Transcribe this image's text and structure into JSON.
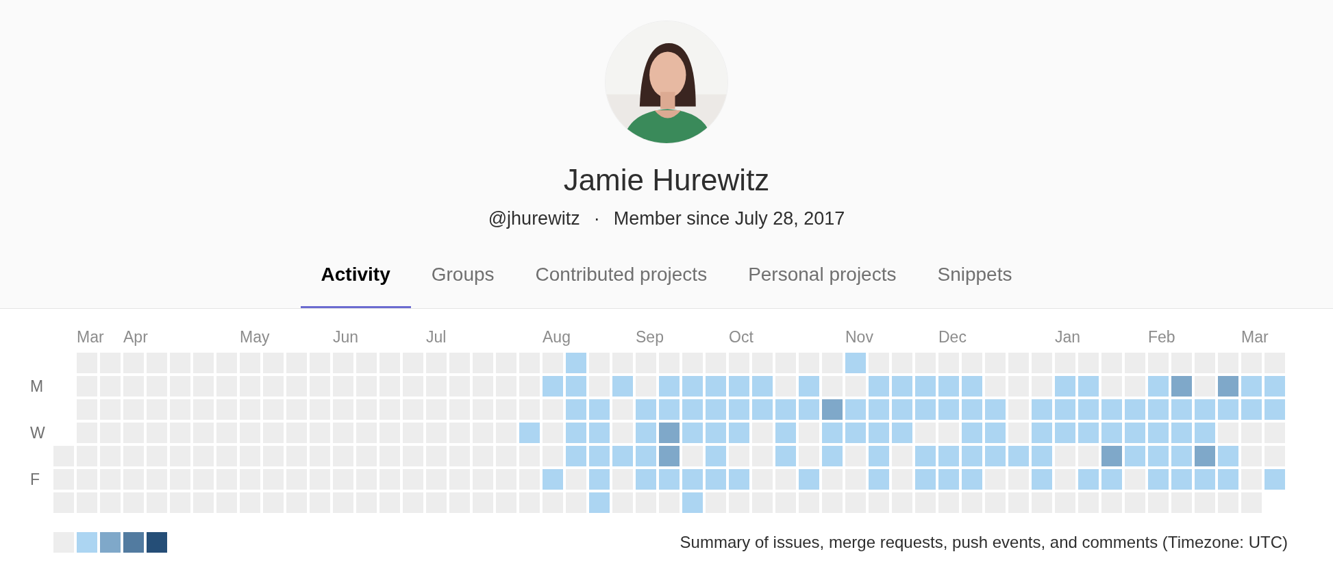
{
  "profile": {
    "name": "Jamie Hurewitz",
    "username": "@jhurewitz",
    "separator": "·",
    "member_since": "Member since July 28, 2017"
  },
  "tabs": [
    {
      "label": "Activity",
      "selected": true
    },
    {
      "label": "Groups",
      "selected": false
    },
    {
      "label": "Contributed projects",
      "selected": false
    },
    {
      "label": "Personal projects",
      "selected": false
    },
    {
      "label": "Snippets",
      "selected": false
    }
  ],
  "calendar": {
    "day_labels": [
      "M",
      "W",
      "F"
    ],
    "weeks": [
      {
        "days": [
          {
            "color": "#ededed"
          },
          {
            "color": "#ededed"
          },
          {
            "color": "#ededed"
          }
        ]
      },
      {
        "month": "Mar",
        "days": [
          {
            "color": "#ededed"
          },
          {
            "color": "#ededed"
          },
          {
            "color": "#ededed"
          },
          {
            "color": "#ededed"
          },
          {
            "color": "#ededed"
          },
          {
            "color": "#ededed"
          },
          {
            "color": "#ededed"
          }
        ]
      },
      {
        "days": [
          {
            "color": "#ededed"
          },
          {
            "color": "#ededed"
          },
          {
            "color": "#ededed"
          },
          {
            "color": "#ededed"
          },
          {
            "color": "#ededed"
          },
          {
            "color": "#ededed"
          },
          {
            "color": "#ededed"
          }
        ]
      },
      {
        "month": "Apr",
        "days": [
          {
            "color": "#ededed"
          },
          {
            "color": "#ededed"
          },
          {
            "color": "#ededed"
          },
          {
            "color": "#ededed"
          },
          {
            "color": "#ededed"
          },
          {
            "color": "#ededed"
          },
          {
            "color": "#ededed"
          }
        ]
      },
      {
        "days": [
          {
            "color": "#ededed"
          },
          {
            "color": "#ededed"
          },
          {
            "color": "#ededed"
          },
          {
            "color": "#ededed"
          },
          {
            "color": "#ededed"
          },
          {
            "color": "#ededed"
          },
          {
            "color": "#ededed"
          }
        ]
      },
      {
        "days": [
          {
            "color": "#ededed"
          },
          {
            "color": "#ededed"
          },
          {
            "color": "#ededed"
          },
          {
            "color": "#ededed"
          },
          {
            "color": "#ededed"
          },
          {
            "color": "#ededed"
          },
          {
            "color": "#ededed"
          }
        ]
      },
      {
        "days": [
          {
            "color": "#ededed"
          },
          {
            "color": "#ededed"
          },
          {
            "color": "#ededed"
          },
          {
            "color": "#ededed"
          },
          {
            "color": "#ededed"
          },
          {
            "color": "#ededed"
          },
          {
            "color": "#ededed"
          }
        ]
      },
      {
        "days": [
          {
            "color": "#ededed"
          },
          {
            "color": "#ededed"
          },
          {
            "color": "#ededed"
          },
          {
            "color": "#ededed"
          },
          {
            "color": "#ededed"
          },
          {
            "color": "#ededed"
          },
          {
            "color": "#ededed"
          }
        ]
      },
      {
        "month": "May",
        "days": [
          {
            "color": "#ededed"
          },
          {
            "color": "#ededed"
          },
          {
            "color": "#ededed"
          },
          {
            "color": "#ededed"
          },
          {
            "color": "#ededed"
          },
          {
            "color": "#ededed"
          },
          {
            "color": "#ededed"
          }
        ]
      },
      {
        "days": [
          {
            "color": "#ededed"
          },
          {
            "color": "#ededed"
          },
          {
            "color": "#ededed"
          },
          {
            "color": "#ededed"
          },
          {
            "color": "#ededed"
          },
          {
            "color": "#ededed"
          },
          {
            "color": "#ededed"
          }
        ]
      },
      {
        "days": [
          {
            "color": "#ededed"
          },
          {
            "color": "#ededed"
          },
          {
            "color": "#ededed"
          },
          {
            "color": "#ededed"
          },
          {
            "color": "#ededed"
          },
          {
            "color": "#ededed"
          },
          {
            "color": "#ededed"
          }
        ]
      },
      {
        "days": [
          {
            "color": "#ededed"
          },
          {
            "color": "#ededed"
          },
          {
            "color": "#ededed"
          },
          {
            "color": "#ededed"
          },
          {
            "color": "#ededed"
          },
          {
            "color": "#ededed"
          },
          {
            "color": "#ededed"
          }
        ]
      },
      {
        "month": "Jun",
        "days": [
          {
            "color": "#ededed"
          },
          {
            "color": "#ededed"
          },
          {
            "color": "#ededed"
          },
          {
            "color": "#ededed"
          },
          {
            "color": "#ededed"
          },
          {
            "color": "#ededed"
          },
          {
            "color": "#ededed"
          }
        ]
      },
      {
        "days": [
          {
            "color": "#ededed"
          },
          {
            "color": "#ededed"
          },
          {
            "color": "#ededed"
          },
          {
            "color": "#ededed"
          },
          {
            "color": "#ededed"
          },
          {
            "color": "#ededed"
          },
          {
            "color": "#ededed"
          }
        ]
      },
      {
        "days": [
          {
            "color": "#ededed"
          },
          {
            "color": "#ededed"
          },
          {
            "color": "#ededed"
          },
          {
            "color": "#ededed"
          },
          {
            "color": "#ededed"
          },
          {
            "color": "#ededed"
          },
          {
            "color": "#ededed"
          }
        ]
      },
      {
        "days": [
          {
            "color": "#ededed"
          },
          {
            "color": "#ededed"
          },
          {
            "color": "#ededed"
          },
          {
            "color": "#ededed"
          },
          {
            "color": "#ededed"
          },
          {
            "color": "#ededed"
          },
          {
            "color": "#ededed"
          }
        ]
      },
      {
        "month": "Jul",
        "days": [
          {
            "color": "#ededed"
          },
          {
            "color": "#ededed"
          },
          {
            "color": "#ededed"
          },
          {
            "color": "#ededed"
          },
          {
            "color": "#ededed"
          },
          {
            "color": "#ededed"
          },
          {
            "color": "#ededed"
          }
        ]
      },
      {
        "days": [
          {
            "color": "#ededed"
          },
          {
            "color": "#ededed"
          },
          {
            "color": "#ededed"
          },
          {
            "color": "#ededed"
          },
          {
            "color": "#ededed"
          },
          {
            "color": "#ededed"
          },
          {
            "color": "#ededed"
          }
        ]
      },
      {
        "days": [
          {
            "color": "#ededed"
          },
          {
            "color": "#ededed"
          },
          {
            "color": "#ededed"
          },
          {
            "color": "#ededed"
          },
          {
            "color": "#ededed"
          },
          {
            "color": "#ededed"
          },
          {
            "color": "#ededed"
          }
        ]
      },
      {
        "days": [
          {
            "color": "#ededed"
          },
          {
            "color": "#ededed"
          },
          {
            "color": "#ededed"
          },
          {
            "color": "#ededed"
          },
          {
            "color": "#ededed"
          },
          {
            "color": "#ededed"
          },
          {
            "color": "#ededed"
          }
        ]
      },
      {
        "days": [
          {
            "color": "#ededed"
          },
          {
            "color": "#ededed"
          },
          {
            "color": "#ededed"
          },
          {
            "color": "#acd5f2"
          },
          {
            "color": "#ededed"
          },
          {
            "color": "#ededed"
          },
          {
            "color": "#ededed"
          }
        ]
      },
      {
        "month": "Aug",
        "days": [
          {
            "color": "#ededed"
          },
          {
            "color": "#acd5f2"
          },
          {
            "color": "#ededed"
          },
          {
            "color": "#ededed"
          },
          {
            "color": "#ededed"
          },
          {
            "color": "#acd5f2"
          },
          {
            "color": "#ededed"
          }
        ]
      },
      {
        "days": [
          {
            "color": "#acd5f2"
          },
          {
            "color": "#acd5f2"
          },
          {
            "color": "#acd5f2"
          },
          {
            "color": "#acd5f2"
          },
          {
            "color": "#acd5f2"
          },
          {
            "color": "#ededed"
          },
          {
            "color": "#ededed"
          }
        ]
      },
      {
        "days": [
          {
            "color": "#ededed"
          },
          {
            "color": "#ededed"
          },
          {
            "color": "#acd5f2"
          },
          {
            "color": "#acd5f2"
          },
          {
            "color": "#acd5f2"
          },
          {
            "color": "#acd5f2"
          },
          {
            "color": "#acd5f2"
          }
        ]
      },
      {
        "days": [
          {
            "color": "#ededed"
          },
          {
            "color": "#acd5f2"
          },
          {
            "color": "#ededed"
          },
          {
            "color": "#ededed"
          },
          {
            "color": "#acd5f2"
          },
          {
            "color": "#ededed"
          },
          {
            "color": "#ededed"
          }
        ]
      },
      {
        "month": "Sep",
        "days": [
          {
            "color": "#ededed"
          },
          {
            "color": "#ededed"
          },
          {
            "color": "#acd5f2"
          },
          {
            "color": "#acd5f2"
          },
          {
            "color": "#acd5f2"
          },
          {
            "color": "#acd5f2"
          },
          {
            "color": "#ededed"
          }
        ]
      },
      {
        "days": [
          {
            "color": "#ededed"
          },
          {
            "color": "#acd5f2"
          },
          {
            "color": "#acd5f2"
          },
          {
            "color": "#7fa8c9"
          },
          {
            "color": "#7fa8c9"
          },
          {
            "color": "#acd5f2"
          },
          {
            "color": "#ededed"
          }
        ]
      },
      {
        "days": [
          {
            "color": "#ededed"
          },
          {
            "color": "#acd5f2"
          },
          {
            "color": "#acd5f2"
          },
          {
            "color": "#acd5f2"
          },
          {
            "color": "#ededed"
          },
          {
            "color": "#acd5f2"
          },
          {
            "color": "#acd5f2"
          }
        ]
      },
      {
        "days": [
          {
            "color": "#ededed"
          },
          {
            "color": "#acd5f2"
          },
          {
            "color": "#acd5f2"
          },
          {
            "color": "#acd5f2"
          },
          {
            "color": "#acd5f2"
          },
          {
            "color": "#acd5f2"
          },
          {
            "color": "#ededed"
          }
        ]
      },
      {
        "month": "Oct",
        "days": [
          {
            "color": "#ededed"
          },
          {
            "color": "#acd5f2"
          },
          {
            "color": "#acd5f2"
          },
          {
            "color": "#acd5f2"
          },
          {
            "color": "#ededed"
          },
          {
            "color": "#acd5f2"
          },
          {
            "color": "#ededed"
          }
        ]
      },
      {
        "days": [
          {
            "color": "#ededed"
          },
          {
            "color": "#acd5f2"
          },
          {
            "color": "#acd5f2"
          },
          {
            "color": "#ededed"
          },
          {
            "color": "#ededed"
          },
          {
            "color": "#ededed"
          },
          {
            "color": "#ededed"
          }
        ]
      },
      {
        "days": [
          {
            "color": "#ededed"
          },
          {
            "color": "#ededed"
          },
          {
            "color": "#acd5f2"
          },
          {
            "color": "#acd5f2"
          },
          {
            "color": "#acd5f2"
          },
          {
            "color": "#ededed"
          },
          {
            "color": "#ededed"
          }
        ]
      },
      {
        "days": [
          {
            "color": "#ededed"
          },
          {
            "color": "#acd5f2"
          },
          {
            "color": "#acd5f2"
          },
          {
            "color": "#ededed"
          },
          {
            "color": "#ededed"
          },
          {
            "color": "#acd5f2"
          },
          {
            "color": "#ededed"
          }
        ]
      },
      {
        "days": [
          {
            "color": "#ededed"
          },
          {
            "color": "#ededed"
          },
          {
            "color": "#7fa8c9"
          },
          {
            "color": "#acd5f2"
          },
          {
            "color": "#acd5f2"
          },
          {
            "color": "#ededed"
          },
          {
            "color": "#ededed"
          }
        ]
      },
      {
        "month": "Nov",
        "days": [
          {
            "color": "#acd5f2"
          },
          {
            "color": "#ededed"
          },
          {
            "color": "#acd5f2"
          },
          {
            "color": "#acd5f2"
          },
          {
            "color": "#ededed"
          },
          {
            "color": "#ededed"
          },
          {
            "color": "#ededed"
          }
        ]
      },
      {
        "days": [
          {
            "color": "#ededed"
          },
          {
            "color": "#acd5f2"
          },
          {
            "color": "#acd5f2"
          },
          {
            "color": "#acd5f2"
          },
          {
            "color": "#acd5f2"
          },
          {
            "color": "#acd5f2"
          },
          {
            "color": "#ededed"
          }
        ]
      },
      {
        "days": [
          {
            "color": "#ededed"
          },
          {
            "color": "#acd5f2"
          },
          {
            "color": "#acd5f2"
          },
          {
            "color": "#acd5f2"
          },
          {
            "color": "#ededed"
          },
          {
            "color": "#ededed"
          },
          {
            "color": "#ededed"
          }
        ]
      },
      {
        "days": [
          {
            "color": "#ededed"
          },
          {
            "color": "#acd5f2"
          },
          {
            "color": "#acd5f2"
          },
          {
            "color": "#ededed"
          },
          {
            "color": "#acd5f2"
          },
          {
            "color": "#acd5f2"
          },
          {
            "color": "#ededed"
          }
        ]
      },
      {
        "month": "Dec",
        "days": [
          {
            "color": "#ededed"
          },
          {
            "color": "#acd5f2"
          },
          {
            "color": "#acd5f2"
          },
          {
            "color": "#ededed"
          },
          {
            "color": "#acd5f2"
          },
          {
            "color": "#acd5f2"
          },
          {
            "color": "#ededed"
          }
        ]
      },
      {
        "days": [
          {
            "color": "#ededed"
          },
          {
            "color": "#acd5f2"
          },
          {
            "color": "#acd5f2"
          },
          {
            "color": "#acd5f2"
          },
          {
            "color": "#acd5f2"
          },
          {
            "color": "#acd5f2"
          },
          {
            "color": "#ededed"
          }
        ]
      },
      {
        "days": [
          {
            "color": "#ededed"
          },
          {
            "color": "#ededed"
          },
          {
            "color": "#acd5f2"
          },
          {
            "color": "#acd5f2"
          },
          {
            "color": "#acd5f2"
          },
          {
            "color": "#ededed"
          },
          {
            "color": "#ededed"
          }
        ]
      },
      {
        "days": [
          {
            "color": "#ededed"
          },
          {
            "color": "#ededed"
          },
          {
            "color": "#ededed"
          },
          {
            "color": "#ededed"
          },
          {
            "color": "#acd5f2"
          },
          {
            "color": "#ededed"
          },
          {
            "color": "#ededed"
          }
        ]
      },
      {
        "days": [
          {
            "color": "#ededed"
          },
          {
            "color": "#ededed"
          },
          {
            "color": "#acd5f2"
          },
          {
            "color": "#acd5f2"
          },
          {
            "color": "#acd5f2"
          },
          {
            "color": "#acd5f2"
          },
          {
            "color": "#ededed"
          }
        ]
      },
      {
        "month": "Jan",
        "days": [
          {
            "color": "#ededed"
          },
          {
            "color": "#acd5f2"
          },
          {
            "color": "#acd5f2"
          },
          {
            "color": "#acd5f2"
          },
          {
            "color": "#ededed"
          },
          {
            "color": "#ededed"
          },
          {
            "color": "#ededed"
          }
        ]
      },
      {
        "days": [
          {
            "color": "#ededed"
          },
          {
            "color": "#acd5f2"
          },
          {
            "color": "#acd5f2"
          },
          {
            "color": "#acd5f2"
          },
          {
            "color": "#ededed"
          },
          {
            "color": "#acd5f2"
          },
          {
            "color": "#ededed"
          }
        ]
      },
      {
        "days": [
          {
            "color": "#ededed"
          },
          {
            "color": "#ededed"
          },
          {
            "color": "#acd5f2"
          },
          {
            "color": "#acd5f2"
          },
          {
            "color": "#7fa8c9"
          },
          {
            "color": "#acd5f2"
          },
          {
            "color": "#ededed"
          }
        ]
      },
      {
        "days": [
          {
            "color": "#ededed"
          },
          {
            "color": "#ededed"
          },
          {
            "color": "#acd5f2"
          },
          {
            "color": "#acd5f2"
          },
          {
            "color": "#acd5f2"
          },
          {
            "color": "#ededed"
          },
          {
            "color": "#ededed"
          }
        ]
      },
      {
        "month": "Feb",
        "days": [
          {
            "color": "#ededed"
          },
          {
            "color": "#acd5f2"
          },
          {
            "color": "#acd5f2"
          },
          {
            "color": "#acd5f2"
          },
          {
            "color": "#acd5f2"
          },
          {
            "color": "#acd5f2"
          },
          {
            "color": "#ededed"
          }
        ]
      },
      {
        "days": [
          {
            "color": "#ededed"
          },
          {
            "color": "#7fa8c9"
          },
          {
            "color": "#acd5f2"
          },
          {
            "color": "#acd5f2"
          },
          {
            "color": "#acd5f2"
          },
          {
            "color": "#acd5f2"
          },
          {
            "color": "#ededed"
          }
        ]
      },
      {
        "days": [
          {
            "color": "#ededed"
          },
          {
            "color": "#ededed"
          },
          {
            "color": "#acd5f2"
          },
          {
            "color": "#acd5f2"
          },
          {
            "color": "#7fa8c9"
          },
          {
            "color": "#acd5f2"
          },
          {
            "color": "#ededed"
          }
        ]
      },
      {
        "days": [
          {
            "color": "#ededed"
          },
          {
            "color": "#7fa8c9"
          },
          {
            "color": "#acd5f2"
          },
          {
            "color": "#ededed"
          },
          {
            "color": "#acd5f2"
          },
          {
            "color": "#acd5f2"
          },
          {
            "color": "#ededed"
          }
        ]
      },
      {
        "month": "Mar",
        "days": [
          {
            "color": "#ededed"
          },
          {
            "color": "#acd5f2"
          },
          {
            "color": "#acd5f2"
          },
          {
            "color": "#ededed"
          },
          {
            "color": "#ededed"
          },
          {
            "color": "#ededed"
          },
          {
            "color": "#ededed"
          }
        ]
      },
      {
        "days": [
          {
            "color": "#ededed"
          },
          {
            "color": "#acd5f2"
          },
          {
            "color": "#acd5f2"
          },
          {
            "color": "#ededed"
          },
          {
            "color": "#ededed"
          },
          {
            "color": "#acd5f2"
          }
        ]
      }
    ],
    "legend": [
      {
        "color": "#ededed"
      },
      {
        "color": "#acd5f2"
      },
      {
        "color": "#7fa8c9"
      },
      {
        "color": "#527ba0"
      },
      {
        "color": "#254e77"
      }
    ],
    "summary": "Summary of issues, merge requests, push events, and comments (Timezone: UTC)"
  }
}
